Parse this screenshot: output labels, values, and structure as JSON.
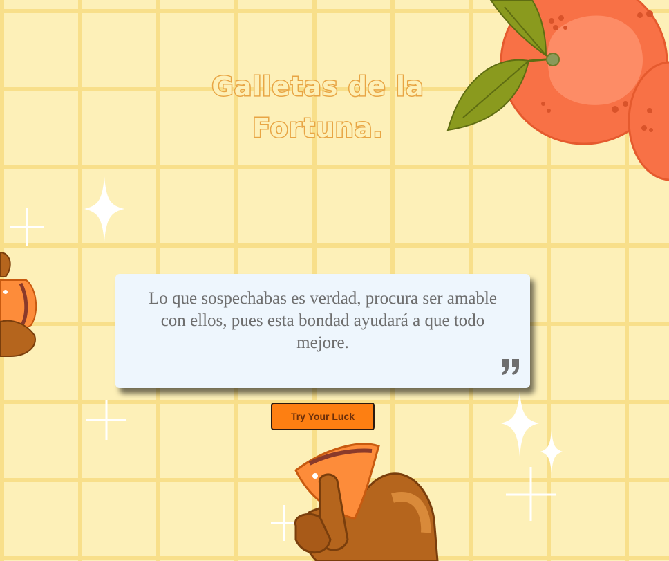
{
  "header": {
    "title": "Galletas de la Fortuna."
  },
  "fortune": {
    "message": "Lo que sospechabas es verdad, procura ser amable con ellos, pues esta bondad ayudará a que todo mejore.",
    "icon": "quote-icon"
  },
  "actions": {
    "try_luck_label": "Try Your Luck"
  },
  "colors": {
    "background": "#fdf0b8",
    "grid_line": "#f8df8a",
    "title_outline": "#e8a544",
    "card": "#eef6fd",
    "button": "#fd7f12",
    "orange_fruit": "#f87146",
    "leaf": "#8a9a1e",
    "hand": "#b5651d"
  }
}
